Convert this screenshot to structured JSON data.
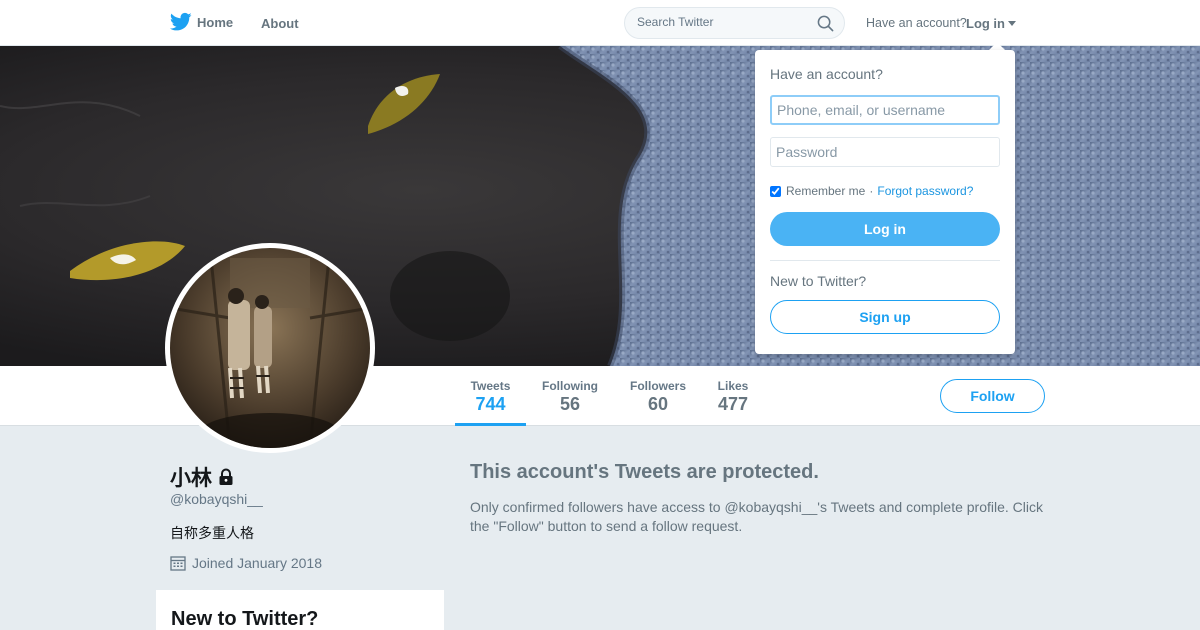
{
  "nav": {
    "home_label": "Home",
    "about_label": "About",
    "search_placeholder": "Search Twitter",
    "have_account": "Have an account?",
    "login_label": "Log in"
  },
  "profile": {
    "name": "小林",
    "handle": "@kobayqshi__",
    "bio": "自称多重人格",
    "joined": "Joined January 2018",
    "follow_label": "Follow"
  },
  "stats": [
    {
      "label": "Tweets",
      "value": "744",
      "active": true
    },
    {
      "label": "Following",
      "value": "56",
      "active": false
    },
    {
      "label": "Followers",
      "value": "60",
      "active": false
    },
    {
      "label": "Likes",
      "value": "477",
      "active": false
    }
  ],
  "protected": {
    "title": "This account's Tweets are protected.",
    "body": "Only confirmed followers have access to @kobayqshi__'s Tweets and complete profile. Click the \"Follow\" button to send a follow request."
  },
  "sidebar_card": {
    "title": "New to Twitter?"
  },
  "login_dropdown": {
    "heading": "Have an account?",
    "username_placeholder": "Phone, email, or username",
    "password_placeholder": "Password",
    "remember_label": "Remember me",
    "separator": "·",
    "forgot_label": "Forgot password?",
    "login_button": "Log in",
    "new_label": "New to Twitter?",
    "signup_button": "Sign up"
  },
  "colors": {
    "accent": "#1da1f2",
    "background": "#e6ecf0",
    "muted_text": "#66757f"
  },
  "icons": [
    "twitter-bird-icon",
    "search-icon",
    "chevron-down-icon",
    "lock-icon",
    "calendar-icon"
  ]
}
